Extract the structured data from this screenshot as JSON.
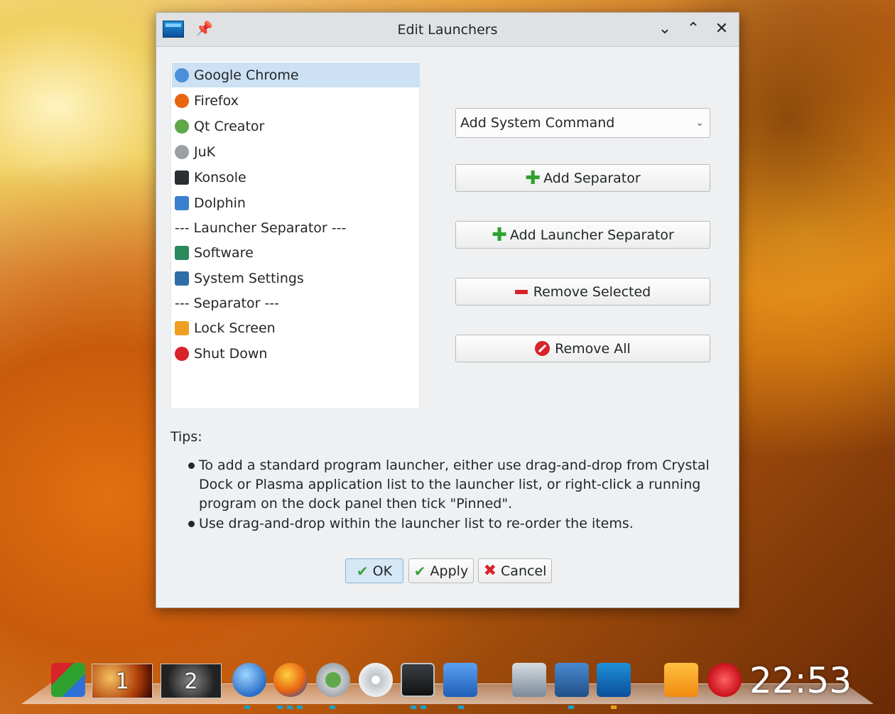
{
  "window": {
    "title": "Edit Launchers",
    "icon": "crystal-dock-icon",
    "pin_icon": "pin-icon",
    "controls": [
      "minimize-icon",
      "maximize-icon",
      "close-icon"
    ]
  },
  "launchers": [
    {
      "label": "Google Chrome",
      "icon": "google-chrome-icon",
      "color": "#4a8fd8",
      "selected": true
    },
    {
      "label": "Firefox",
      "icon": "firefox-icon",
      "color": "#e8650f"
    },
    {
      "label": "Qt Creator",
      "icon": "qt-creator-icon",
      "color": "#5fa84a"
    },
    {
      "label": "JuK",
      "icon": "juk-icon",
      "color": "#9aa0a4"
    },
    {
      "label": "Konsole",
      "icon": "konsole-icon",
      "color": "#2b2f33"
    },
    {
      "label": "Dolphin",
      "icon": "dolphin-icon",
      "color": "#3a7fd0"
    },
    {
      "label": "--- Launcher Separator ---",
      "separator": true
    },
    {
      "label": "Software",
      "icon": "software-icon",
      "color": "#2a8a5c"
    },
    {
      "label": "System Settings",
      "icon": "system-settings-icon",
      "color": "#2f6fa8"
    },
    {
      "label": "--- Separator ---",
      "separator": true
    },
    {
      "label": "Lock Screen",
      "icon": "lock-screen-icon",
      "color": "#f0a020"
    },
    {
      "label": "Shut Down",
      "icon": "shut-down-icon",
      "color": "#d8232a"
    }
  ],
  "actions": {
    "system_command_combo": "Add System Command",
    "add_separator": "Add Separator",
    "add_launcher_separator": "Add Launcher Separator",
    "remove_selected": "Remove Selected",
    "remove_all": "Remove All"
  },
  "tips": {
    "title": "Tips:",
    "items": [
      "To add a standard program launcher, either use drag-and-drop from Crystal Dock or Plasma application list to the launcher list, or right-click a running program on the dock panel then tick \"Pinned\".",
      "Use drag-and-drop within the launcher list to re-order the items."
    ]
  },
  "buttons": {
    "ok": "OK",
    "apply": "Apply",
    "cancel": "Cancel"
  },
  "dock": {
    "desktops": [
      "1",
      "2"
    ],
    "clock": "22:53",
    "apps": [
      "application-menu-icon",
      "web-browser-icon",
      "firefox-icon",
      "qt-creator-icon",
      "juk-icon",
      "konsole-icon",
      "dolphin-icon",
      "software-icon",
      "system-settings-icon",
      "crystal-dock-icon",
      "lock-screen-icon",
      "shut-down-icon"
    ]
  }
}
